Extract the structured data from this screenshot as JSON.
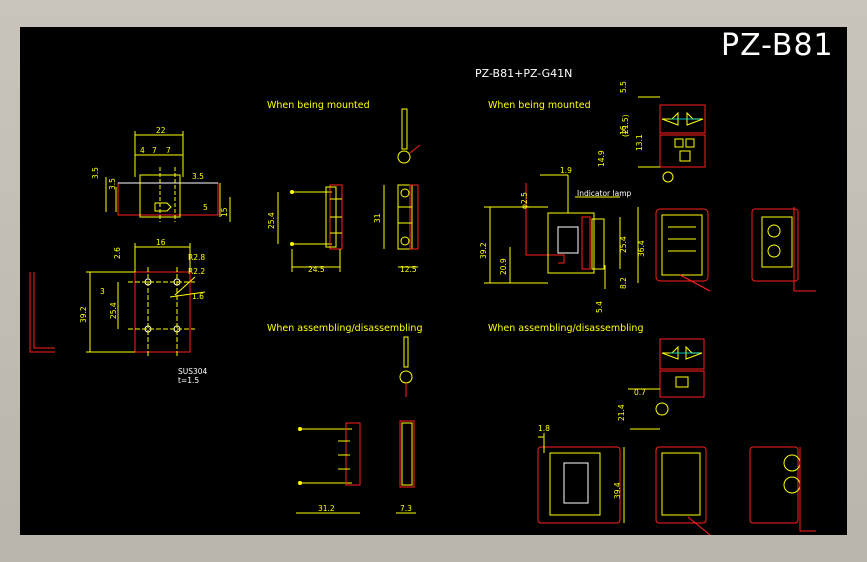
{
  "drawing": {
    "title": "PZ-B81",
    "subtitle": "PZ-B81+PZ-G41N",
    "views": {
      "mounted_left": "When being mounted",
      "mounted_right": "When being mounted",
      "assembling_left": "When assembling/disassembling",
      "assembling_right": "When assembling/disassembling"
    },
    "annotations": {
      "indicator": "Indicator lamp",
      "material": "SUS304",
      "thickness": "t=1.5"
    },
    "dimensions": {
      "d22": "22",
      "d4": "4",
      "d7a": "7",
      "d7b": "7",
      "d3_5a": "3.5",
      "d3_5b": "3.5",
      "d3_5c": "3.5",
      "d5": "5",
      "d15": "15",
      "d16": "16",
      "d2_6": "2.6",
      "r2_8": "R2.8",
      "r2_2": "R2.2",
      "d3": "3",
      "d1_6": "1.6",
      "d25_4a": "25.4",
      "d39_2a": "39.2",
      "d25_4b": "25.4",
      "d24_5": "24.5",
      "d31": "31",
      "d12_5": "12.5",
      "d5_5": "5.5",
      "d21_5": "(21.5)",
      "d16b": "16",
      "d13_1": "13.1",
      "d14_9": "14.9",
      "d1_9": "1.9",
      "d2_5": "φ2.5",
      "d39_2b": "39.2",
      "d20_9": "20.9",
      "d25_4c": "25.4",
      "d36_4": "36.4",
      "d8_2": "8.2",
      "d5_4": "5.4",
      "d0_7": "0.7",
      "d21_4": "21.4",
      "d31_2": "31.2",
      "d7_3": "7.3",
      "d1_8": "1.8",
      "d39_4": "39.4"
    }
  },
  "colors": {
    "background": "#000000",
    "dimension": "#ffff00",
    "outline": "#ff2020",
    "text": "#ffffff",
    "accent": "#00ffff"
  }
}
